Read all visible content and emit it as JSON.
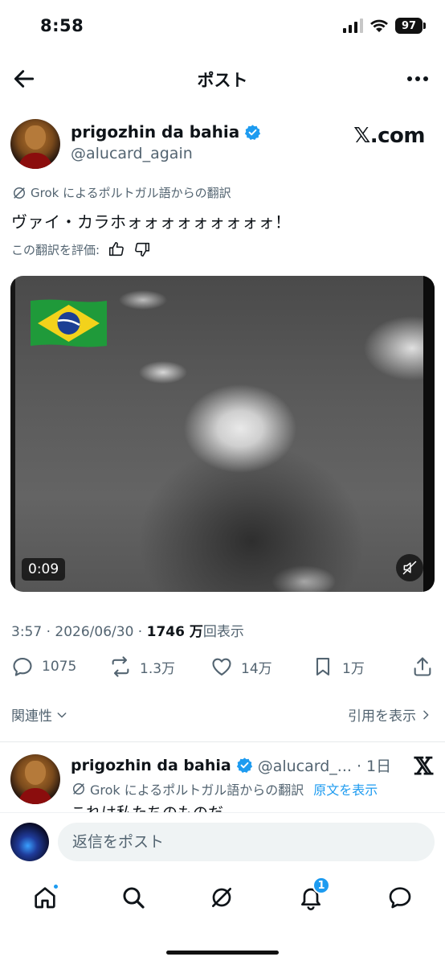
{
  "status_bar": {
    "time": "8:58",
    "battery": "97"
  },
  "header": {
    "title": "ポスト",
    "back_icon": "arrow-left-icon",
    "more_icon": "more-dots-icon"
  },
  "post": {
    "author_name": "prigozhin da bahia",
    "author_handle": "@alucard_again",
    "watermark": "𝕏.com",
    "translation_notice": "Grok によるポルトガル語からの翻訳",
    "text": "ヴァイ・カラホォォォォォォォォォ！",
    "rate_label": "この翻訳を評価:",
    "video_duration": "0:09",
    "time": "3:57",
    "date": "2026/06/30",
    "views_count": "1746 万",
    "views_label": "回表示",
    "replies": "1075",
    "reposts": "1.3万",
    "likes": "14万",
    "bookmarks": "1万"
  },
  "related": {
    "label": "関連性",
    "quotes_label": "引用を表示"
  },
  "reply": {
    "author_name": "prigozhin da bahia",
    "handle_time": "@alucard_... · 1日",
    "translation_notice": "Grok によるポルトガル語からの翻訳",
    "show_original": "原文を表示",
    "text": "これは私たちのものだ"
  },
  "composer": {
    "placeholder": "返信をポスト"
  },
  "tabbar": {
    "notifications_badge": "1"
  },
  "colors": {
    "accent": "#1d9bf0",
    "text": "#0f1419",
    "secondary": "#536471"
  }
}
